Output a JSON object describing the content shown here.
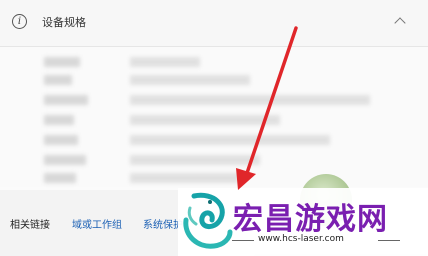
{
  "header": {
    "title": "设备规格",
    "info_icon": "info-icon",
    "collapse_icon": "chevron-up-icon"
  },
  "related_links": {
    "label": "相关链接",
    "links": [
      "域或工作组",
      "系统保护"
    ]
  },
  "watermark": {
    "brand": "宏昌游戏网",
    "url": "www.hcs-laser.com",
    "brand_color": "#7a1fb0",
    "logo": "dragon-logo"
  },
  "colors": {
    "arrow": "#e0262a",
    "link": "#1a5fb4"
  }
}
